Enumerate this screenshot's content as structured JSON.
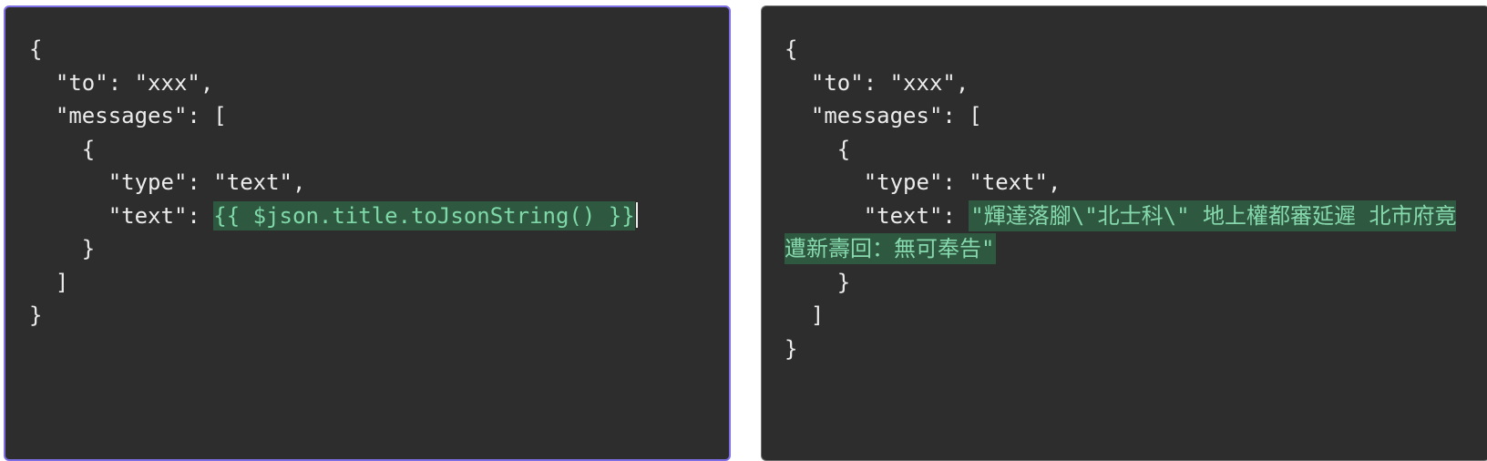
{
  "editor": {
    "lines": [
      "{",
      "  \"to\": \"xxx\",",
      "  \"messages\": [",
      "    {",
      "      \"type\": \"text\",",
      "      \"text\": ",
      "    }",
      "  ]",
      "}"
    ],
    "expression": "{{ $json.title.toJsonString() }}"
  },
  "preview": {
    "lines": [
      "{",
      "  \"to\": \"xxx\",",
      "  \"messages\": [",
      "    {",
      "      \"type\": \"text\",",
      "      \"text\": ",
      "    }",
      "  ]",
      "}"
    ],
    "resolved_value": "\"輝達落腳\\\"北士科\\\" 地上權都審延遲 北市府竟遭新壽回：無可奉告\""
  },
  "colors": {
    "panel_bg": "#2d2d2d",
    "focus_border": "#7e6ee6",
    "highlight_bg": "#2e5840",
    "highlight_text": "#7fd8a8",
    "text": "#ececec"
  }
}
